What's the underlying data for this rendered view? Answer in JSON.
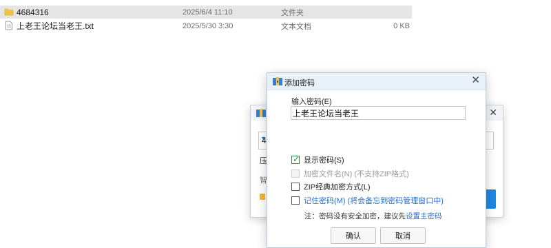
{
  "files": [
    {
      "name": "4684316",
      "date": "2025/6/4 11:10",
      "type": "文件夹",
      "size": "",
      "icon": "folder-icon",
      "selected": true
    },
    {
      "name": "上老王论坛当老王.txt",
      "date": "2025/5/30 3:30",
      "type": "文本文档",
      "size": "0 KB",
      "icon": "text-file-icon",
      "selected": false
    }
  ],
  "bg_dialog": {
    "field_text": "46",
    "label_1": "压",
    "label_2": "智",
    "close": "✕"
  },
  "dialog": {
    "title": "添加密码",
    "close": "✕",
    "password_label": "输入密码(E)",
    "password_value": "上老王论坛当老王",
    "options": {
      "show_password": "显示密码(S)",
      "encrypt_filenames": "加密文件名(N) (不支持ZIP格式)",
      "zip_legacy": "ZIP经典加密方式(L)",
      "remember_password": "记住密码(M) (将会备忘到密码管理窗口中)"
    },
    "note_prefix": "注：密码没有安全加密，建议先",
    "note_link": "设置主密码",
    "ok": "确认",
    "cancel": "取消"
  },
  "colors": {
    "link": "#1e6fd9",
    "check": "#2c8a3e",
    "folder": "#f5c342"
  }
}
